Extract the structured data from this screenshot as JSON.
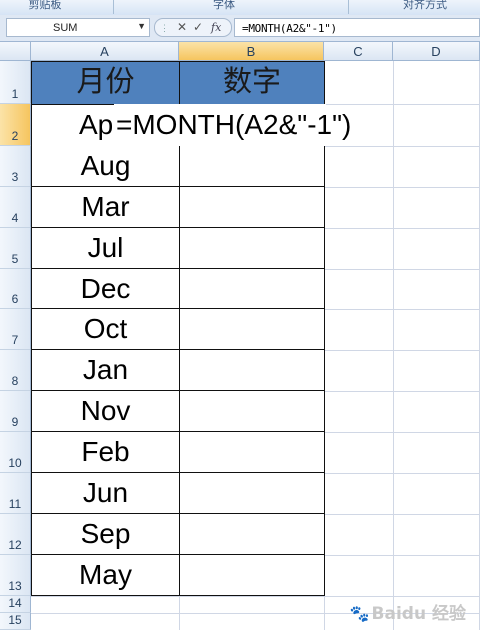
{
  "ribbon": {
    "groups": [
      "剪贴板",
      "字体",
      "对齐方式"
    ]
  },
  "formula_bar": {
    "name_box": "SUM",
    "cancel_symbol": "✕",
    "enter_symbol": "✓",
    "fx_label": "fx",
    "formula": "=MONTH(A2&\"-1\")"
  },
  "columns": [
    "A",
    "B",
    "C",
    "D"
  ],
  "rows": [
    "1",
    "2",
    "3",
    "4",
    "5",
    "6",
    "7",
    "8",
    "9",
    "10",
    "11",
    "12",
    "13",
    "14",
    "15"
  ],
  "table": {
    "headers": [
      "月份",
      "数字"
    ],
    "a2_visible": "Ap",
    "editing_text": "=MONTH(A2&\"-1\")",
    "months": [
      "Aug",
      "Mar",
      "Jul",
      "Dec",
      "Oct",
      "Jan",
      "Nov",
      "Feb",
      "Jun",
      "Sep",
      "May"
    ]
  },
  "watermark": "Baidu 经验",
  "colors": {
    "header_fill": "#4f81bd",
    "selection_header": "#f6c55f"
  }
}
